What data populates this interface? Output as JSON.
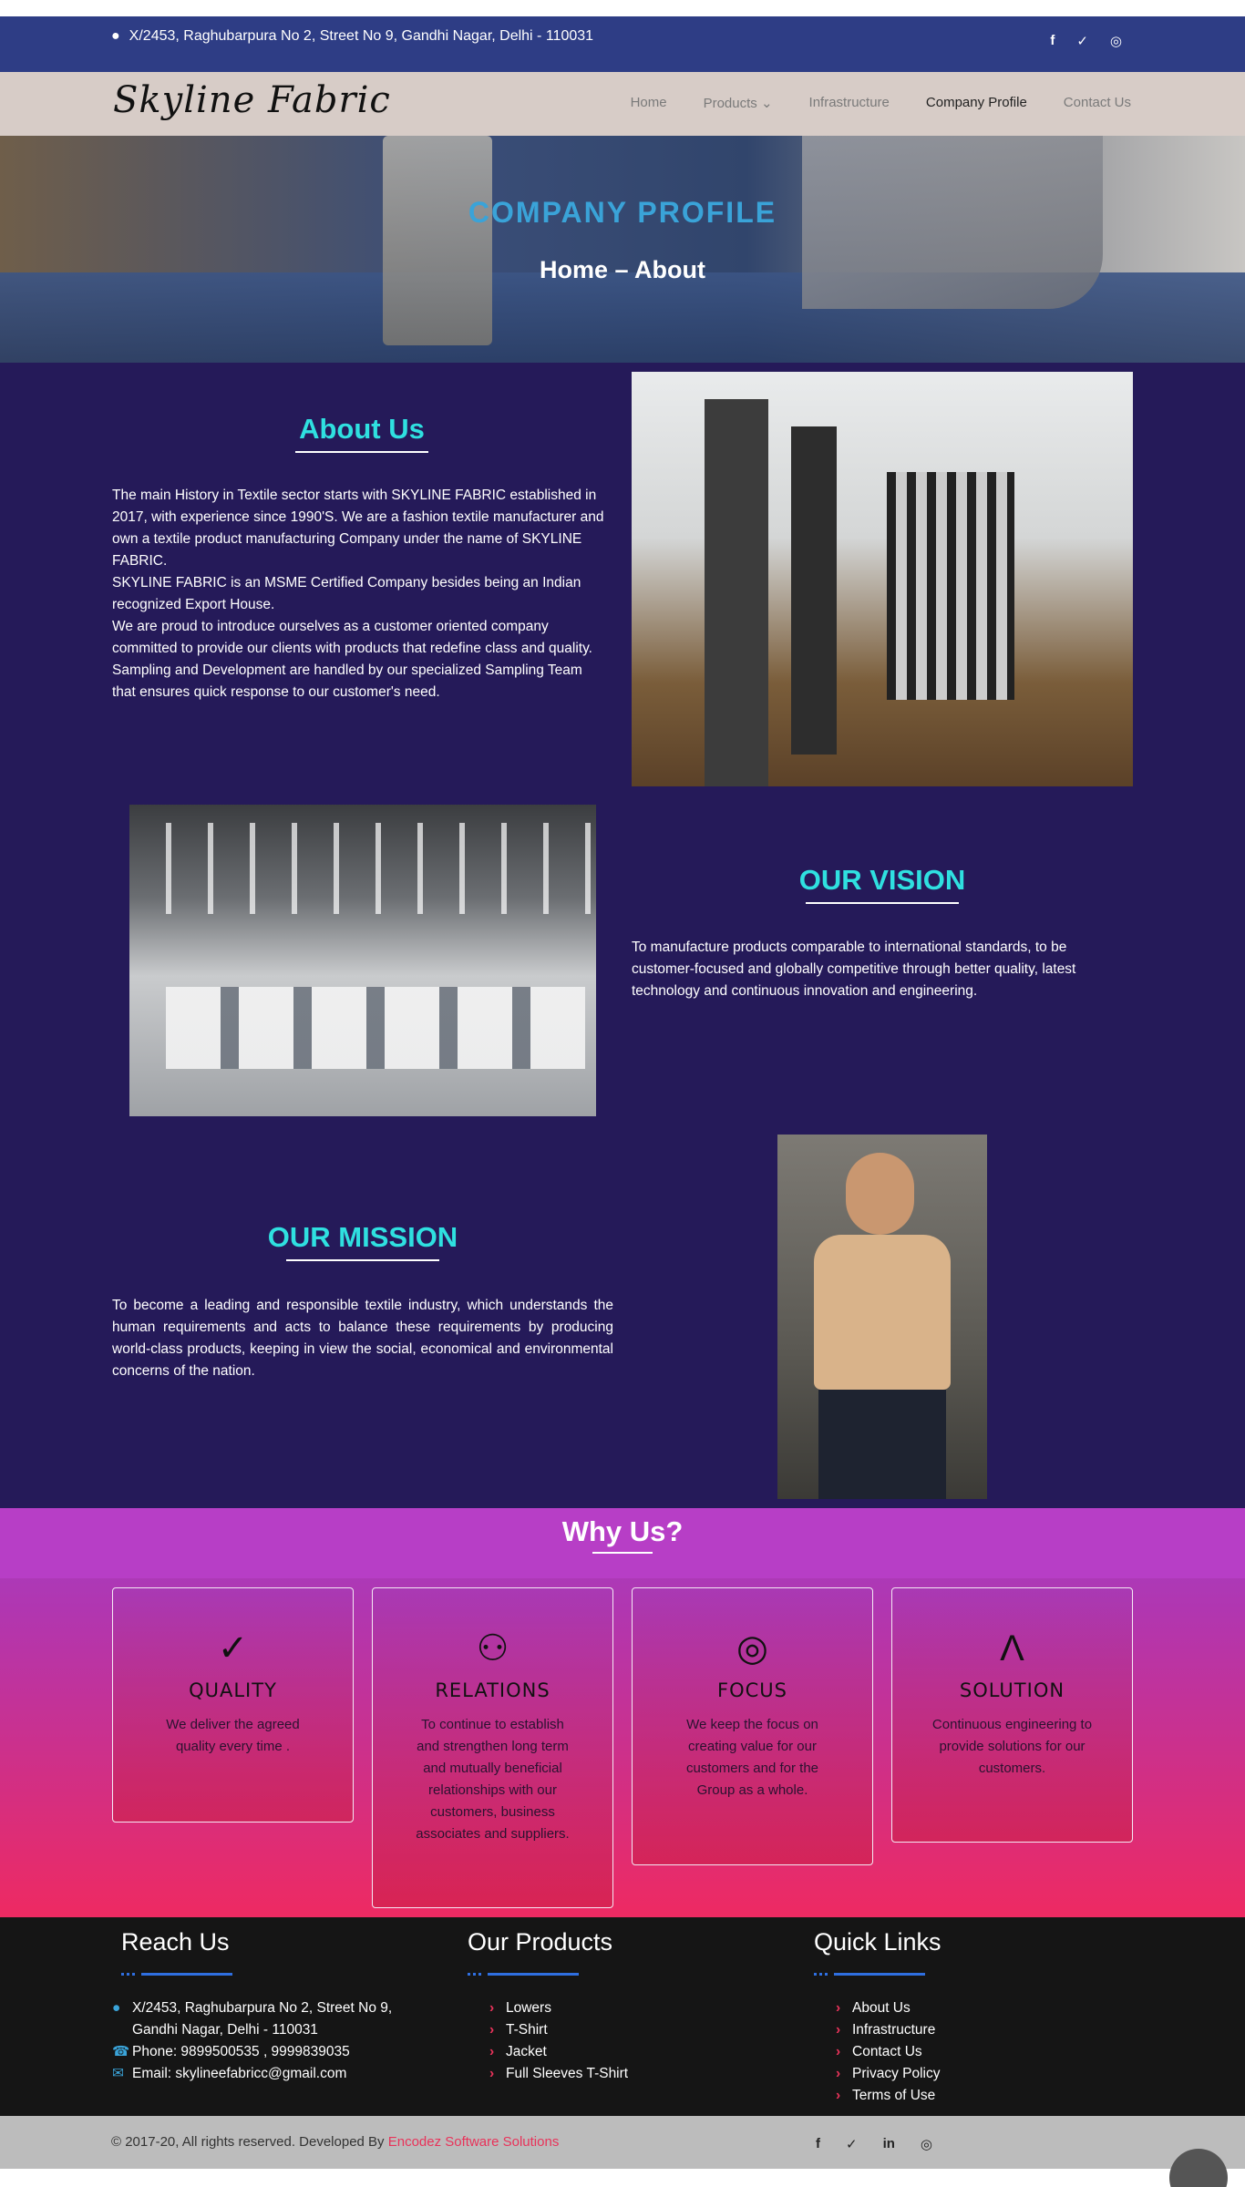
{
  "topbar": {
    "address": "X/2453, Raghubarpura No 2, Street No 9, Gandhi Nagar, Delhi - 110031",
    "social_icons": [
      "facebook-icon",
      "twitter-icon",
      "instagram-icon"
    ],
    "social_glyphs": [
      "f",
      "✓",
      "◎"
    ]
  },
  "nav": {
    "logo": "Skyline Fabric",
    "items": [
      "Home",
      "Products",
      "Infrastructure",
      "Company Profile",
      "Contact Us"
    ],
    "products_caret": "⌄",
    "active": "Company Profile"
  },
  "hero": {
    "title": "COMPANY PROFILE",
    "breadcrumb": "Home – About"
  },
  "about": {
    "title": "About Us",
    "paragraphs": [
      "The main History in Textile sector starts with SKYLINE FABRIC established in 2017, with experience since 1990'S. We are a fashion textile manufacturer and own a textile product manufacturing Company under the name of SKYLINE FABRIC.",
      "SKYLINE FABRIC is an MSME Certified Company besides being an Indian recognized Export House.",
      "We are proud to introduce ourselves as a customer oriented company committed to provide our clients with products that redefine class and quality. Sampling and Development are handled by our specialized Sampling Team that ensures quick response to our customer's need."
    ]
  },
  "vision": {
    "title": "OUR VISION",
    "text": "To manufacture products comparable to international standards, to be customer-focused and globally competitive through better quality, latest technology and continuous innovation and engineering."
  },
  "mission": {
    "title": "OUR MISSION",
    "text": "To become a leading and responsible textile industry, which understands the human requirements and acts to balance these requirements by producing world-class products, keeping in view the social, economical and environmental concerns of the nation."
  },
  "why": {
    "title": "Why Us?",
    "cards": [
      {
        "icon": "✓",
        "title": "QUALITY",
        "text": "We deliver the agreed quality every time ."
      },
      {
        "icon": "⚇",
        "title": "RELATIONS",
        "text": "To continue to establish and strengthen long term and mutually beneficial relationships with our customers, business associates and suppliers."
      },
      {
        "icon": "◎",
        "title": "FOCUS",
        "text": "We keep the focus on creating value for our customers and for the Group as a whole."
      },
      {
        "icon": "Λ",
        "title": "SOLUTION",
        "text": "Continuous engineering to provide solutions for our customers."
      }
    ]
  },
  "footer": {
    "reach": {
      "title": "Reach Us",
      "address_line1": "X/2453, Raghubarpura No 2, Street No 9,",
      "address_line2": "Gandhi Nagar, Delhi - 110031",
      "phone": "Phone: 9899500535 , 9999839035",
      "email": "Email: skylineefabricc@gmail.com"
    },
    "products": {
      "title": "Our Products",
      "items": [
        "Lowers",
        "T-Shirt",
        "Jacket",
        "Full Sleeves T-Shirt"
      ]
    },
    "links": {
      "title": "Quick Links",
      "items": [
        "About Us",
        "Infrastructure",
        "Contact Us",
        "Privacy Policy",
        "Terms of Use"
      ]
    },
    "copyright": "© 2017-20, All rights reserved. Developed By ",
    "developer": "Encodez Software Solutions",
    "social_icons": [
      "facebook-icon",
      "twitter-icon",
      "linkedin-icon",
      "instagram-icon"
    ],
    "social_glyphs": [
      "f",
      "✓",
      "in",
      "◎"
    ]
  },
  "colors": {
    "topbar": "#2e3d85",
    "accent_title": "#2fe0e0",
    "section_bg": "#251a59",
    "link_accent": "#e8335a"
  }
}
